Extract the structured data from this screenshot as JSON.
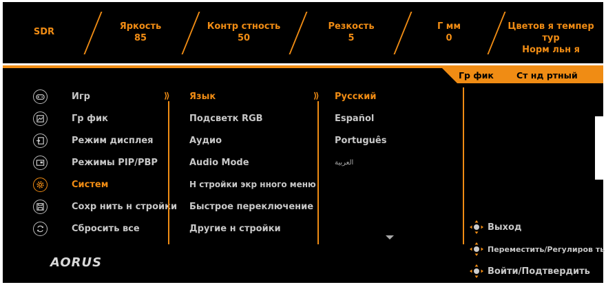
{
  "header": {
    "mode": "SDR",
    "stats": [
      {
        "label": "Яркость",
        "value": "85"
      },
      {
        "label": "Контр стность",
        "value": "50"
      },
      {
        "label": "Резкость",
        "value": "5"
      },
      {
        "label": "Г мм",
        "value": "0"
      },
      {
        "label": "Цветов я темпер тур",
        "value": "Норм льн я"
      }
    ]
  },
  "tabs": {
    "left": "Гр фик",
    "right": "Ст нд ртный"
  },
  "menu": {
    "items": [
      {
        "label": "Игр",
        "icon": "gamepad-icon"
      },
      {
        "label": "Гр фик",
        "icon": "picture-icon"
      },
      {
        "label": "Режим дисплея",
        "icon": "display-input-icon"
      },
      {
        "label": "Режимы PIP/PBP",
        "icon": "pip-icon"
      },
      {
        "label": "Систем",
        "icon": "gear-icon",
        "active": true
      },
      {
        "label": "Сохр нить н стройки",
        "icon": "save-icon"
      },
      {
        "label": "Сбросить все",
        "icon": "reset-icon"
      }
    ]
  },
  "submenu": {
    "items": [
      {
        "label": "Язык",
        "active": true
      },
      {
        "label": "Подсветк RGB"
      },
      {
        "label": "Аудио"
      },
      {
        "label": "Audio Mode"
      },
      {
        "label": "Н стройки экр нного меню"
      },
      {
        "label": "Быстрое переключение"
      },
      {
        "label": "Другие н стройки"
      }
    ]
  },
  "languages": {
    "items": [
      {
        "label": "Русский",
        "active": true
      },
      {
        "label": "Español"
      },
      {
        "label": "Português"
      },
      {
        "label": "العربية"
      }
    ]
  },
  "hints": {
    "exit": "Выход",
    "move": "Переместить/Регулиров ть",
    "enter": "Войти/Подтвердить"
  },
  "logo": "AORUS",
  "colors": {
    "accent": "#f08c14",
    "text": "#c8c8c8",
    "background": "#000000"
  }
}
